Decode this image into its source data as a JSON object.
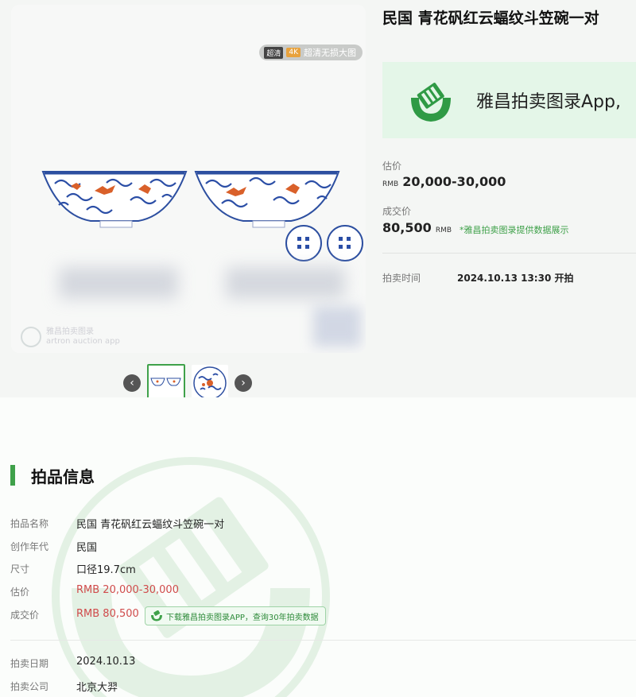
{
  "gallery": {
    "badge_tag1": "超清",
    "badge_tag2": "4K",
    "badge_text": "超清无损大图",
    "watermark_line1": "雅昌拍卖图录",
    "watermark_line2": "artron auction app",
    "prev_symbol": "‹",
    "next_symbol": "›"
  },
  "lot": {
    "title": "民国 青花矾红云蝠纹斗笠碗一对"
  },
  "banner": {
    "text": "雅昌拍卖图录App,"
  },
  "price": {
    "estimate_label": "估价",
    "estimate_currency": "RMB",
    "estimate_value": "20,000-30,000",
    "sold_label": "成交价",
    "sold_value": "80,500",
    "sold_currency": "RMB",
    "sold_note": "*雅昌拍卖图录提供数据展示",
    "time_label": "拍卖时间",
    "time_value": "2024.10.13 13:30 开拍"
  },
  "details": {
    "section_title": "拍品信息",
    "rows": [
      {
        "label": "拍品名称",
        "value": "民国 青花矾红云蝠纹斗笠碗一对"
      },
      {
        "label": "创作年代",
        "value": "民国"
      },
      {
        "label": "尺寸",
        "value": "口径19.7cm"
      },
      {
        "label": "估价",
        "value": "RMB 20,000-30,000"
      },
      {
        "label": "成交价",
        "value": "RMB 80,500"
      },
      {
        "label": "拍卖日期",
        "value": "2024.10.13"
      },
      {
        "label": "拍卖公司",
        "value": "北京大羿"
      }
    ],
    "download_button": "下载雅昌拍卖图录APP，查询30年拍卖数据"
  },
  "colors": {
    "accent": "#3fa14a",
    "price_red": "#d04b4b"
  }
}
